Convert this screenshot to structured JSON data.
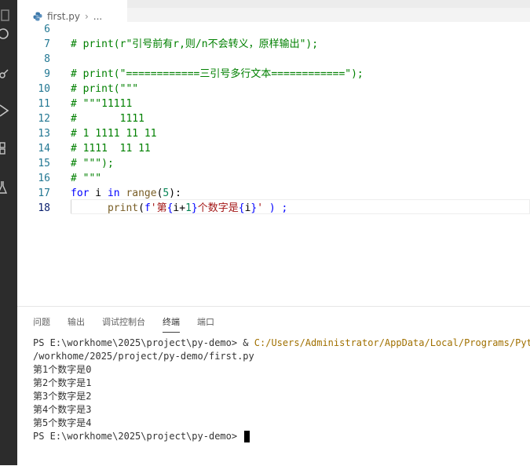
{
  "tab": {
    "filename": "first.py",
    "breadcrumb_sep": "›",
    "breadcrumb_more": "..."
  },
  "editor": {
    "lines": [
      {
        "num": "6",
        "text": ""
      },
      {
        "num": "7",
        "text": "# print(r\"引号前有r,则/n不会转义，原样输出\");"
      },
      {
        "num": "8",
        "text": ""
      },
      {
        "num": "9",
        "text": "# print(\"============三引号多行文本============\");"
      },
      {
        "num": "10",
        "text": "# print(\"\"\""
      },
      {
        "num": "11",
        "text": "# \"\"\"11111"
      },
      {
        "num": "12",
        "text": "#       1111"
      },
      {
        "num": "13",
        "text": "# 1 1111 11 11"
      },
      {
        "num": "14",
        "text": "# 1111  11 11"
      },
      {
        "num": "15",
        "text": "# \"\"\");"
      },
      {
        "num": "16",
        "text": "# \"\"\""
      },
      {
        "num": "17",
        "for_kw": "for",
        "var": " i ",
        "in_kw": "in",
        "fn": " range",
        "open": "(",
        "num_val": "5",
        "close": "):"
      },
      {
        "num": "18",
        "indent": "      ",
        "fn": "print",
        "open": "(",
        "fprefix": "f",
        "s1": "'第",
        "b1": "{",
        "expr1": "i+",
        "expr1num": "1",
        "b2": "}",
        "s2": "个数字是",
        "b3": "{",
        "expr2": "i",
        "b4": "}",
        "s3": "'",
        "close": " ) ;"
      }
    ]
  },
  "panel": {
    "tabs": [
      "问题",
      "输出",
      "调试控制台",
      "终端",
      "端口"
    ],
    "active_tab": "终端",
    "terminal": {
      "prompt1": "PS E:\\workhome\\2025\\project\\py-demo> & ",
      "exe_path": "C:/Users/Administrator/AppData/Local/Programs/Python",
      "script_path": "/workhome/2025/project/py-demo/first.py",
      "outputs": [
        "第1个数字是0",
        "第2个数字是1",
        "第3个数字是2",
        "第4个数字是3",
        "第5个数字是4"
      ],
      "prompt2": "PS E:\\workhome\\2025\\project\\py-demo> "
    }
  },
  "colors": {
    "activity_bar": "#2c2c2c",
    "comment": "#008000",
    "keyword": "#0000ff",
    "string": "#a31515",
    "line_number": "#237893"
  }
}
